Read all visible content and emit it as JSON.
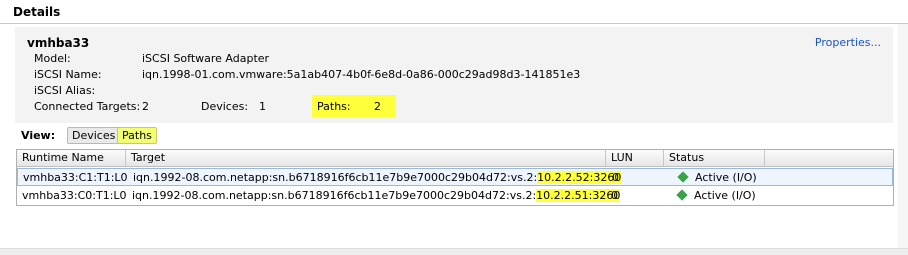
{
  "section": {
    "title": "Details"
  },
  "adapter": {
    "name": "vmhba33",
    "properties_link": "Properties...",
    "fields": [
      {
        "label": "Model:",
        "value": "iSCSI Software Adapter"
      },
      {
        "label": "iSCSI Name:",
        "value": "iqn.1998-01.com.vmware:5a1ab407-4b0f-6e8d-0a86-000c29ad98d3-141851e3"
      },
      {
        "label": "iSCSI Alias:",
        "value": ""
      }
    ],
    "connected_targets": {
      "label": "Connected Targets:",
      "value": "2"
    },
    "devices": {
      "label": "Devices:",
      "value": "1"
    },
    "paths": {
      "label": "Paths:",
      "value": "2"
    }
  },
  "view": {
    "label": "View:",
    "devices_button": "Devices",
    "paths_button": "Paths",
    "selected": "Paths"
  },
  "table": {
    "columns": [
      "Runtime Name",
      "Target",
      "LUN",
      "Status"
    ],
    "rows": [
      {
        "runtime_name": "vmhba33:C1:T1:L0",
        "target_prefix": "iqn.1992-08.com.netapp:sn.b6718916f6cb11e7b9e7000c29b04d72:vs.2:",
        "target_ip": "10.2.2.52:3260",
        "lun": "0",
        "status": "Active (I/O)"
      },
      {
        "runtime_name": "vmhba33:C0:T1:L0",
        "target_prefix": "iqn.1992-08.com.netapp:sn.b6718916f6cb11e7b9e7000c29b04d72:vs.2:",
        "target_ip": "10.2.2.51:3260",
        "lun": "0",
        "status": "Active (I/O)"
      }
    ]
  },
  "colors": {
    "highlight": "#ffff3c",
    "status_active": "#3aa34a",
    "link": "#1a55c0"
  }
}
